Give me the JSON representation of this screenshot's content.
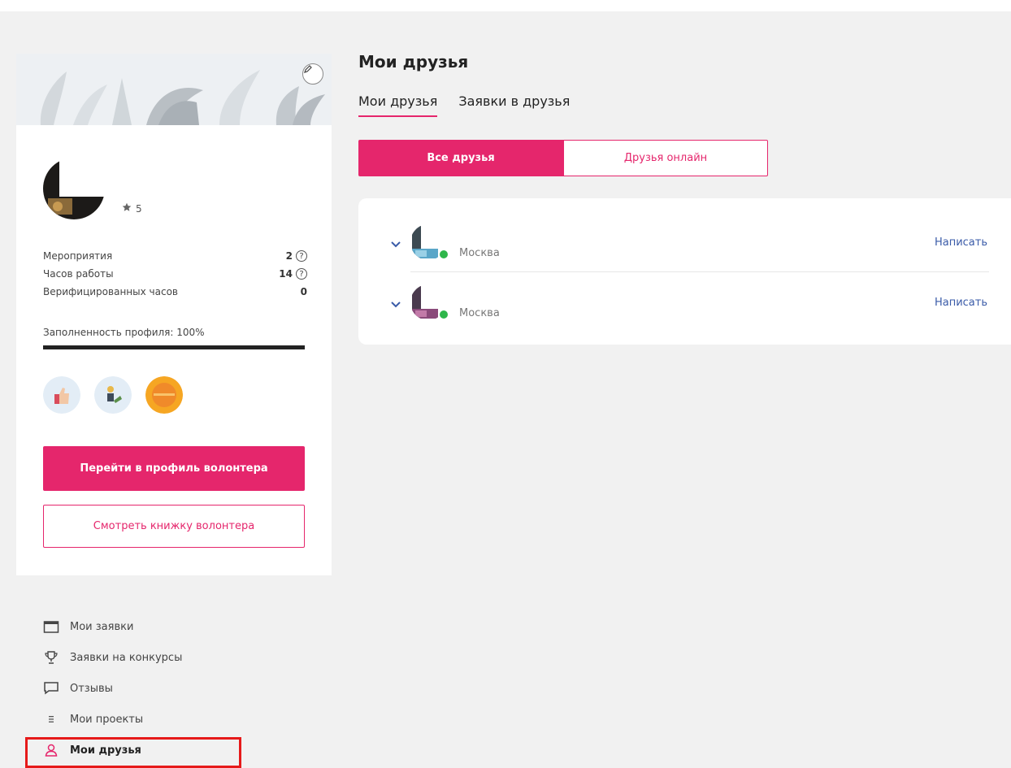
{
  "profile": {
    "rating": "5",
    "stats": [
      {
        "label": "Мероприятия",
        "value": "2",
        "help": "?"
      },
      {
        "label": "Часов работы",
        "value": "14",
        "help": "?"
      },
      {
        "label": "Верифицированных часов",
        "value": "0",
        "help": ""
      }
    ],
    "fill_label": "Заполненность профиля: 100%",
    "fill_percent": 100,
    "primary_button": "Перейти в профиль волонтера",
    "secondary_button": "Смотреть книжку волонтера"
  },
  "nav": {
    "items": [
      {
        "label": "Мои заявки",
        "icon": "calendar-icon"
      },
      {
        "label": "Заявки на конкурсы",
        "icon": "trophy-icon"
      },
      {
        "label": "Отзывы",
        "icon": "comment-icon"
      },
      {
        "label": "Мои проекты",
        "icon": "list-icon"
      },
      {
        "label": "Мои друзья",
        "icon": "user-icon",
        "active": true
      }
    ]
  },
  "main": {
    "title": "Мои друзья",
    "tabs": [
      {
        "label": "Мои друзья",
        "active": true
      },
      {
        "label": "Заявки в друзья",
        "active": false
      }
    ],
    "filter": {
      "all": "Все друзья",
      "online": "Друзья онлайн"
    },
    "friends": [
      {
        "city": "Москва",
        "action": "Написать",
        "online": true
      },
      {
        "city": "Москва",
        "action": "Написать",
        "online": true
      }
    ]
  },
  "colors": {
    "accent": "#e5266c",
    "link": "#3a5ba8",
    "online": "#2eb64a",
    "highlight": "#e61a1a"
  }
}
